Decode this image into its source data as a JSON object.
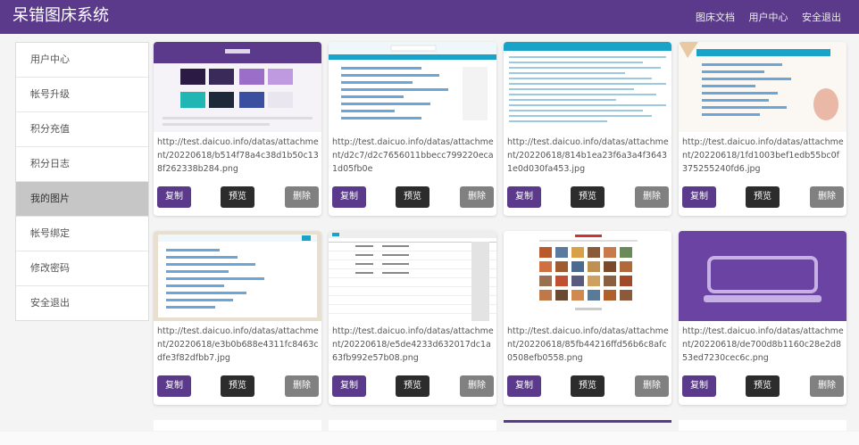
{
  "header": {
    "brand": "呆错图床系统",
    "nav": [
      "图床文档",
      "用户中心",
      "安全退出"
    ]
  },
  "sidebar": {
    "items": [
      "用户中心",
      "帐号升级",
      "积分充值",
      "积分日志",
      "我的图片",
      "帐号绑定",
      "修改密码",
      "安全退出"
    ],
    "active": "我的图片"
  },
  "cards": [
    {
      "url": "http://test.daicuo.info/datas/attachment/20220618/b514f78a4c38d1b50c138f262338b284.png",
      "thumb": "purple-site"
    },
    {
      "url": "http://test.daicuo.info/datas/attachment/d2c7/d2c7656011bbecc799220eca1d05fb0e",
      "thumb": "doc-list"
    },
    {
      "url": "http://test.daicuo.info/datas/attachment/20220618/814b1ea23f6a3a4f36431e0d030fa453.jpg",
      "thumb": "code-page"
    },
    {
      "url": "http://test.daicuo.info/datas/attachment/20220618/1fd1003bef1edb55bc0f375255240fd6.jpg",
      "thumb": "doc-list-deco"
    },
    {
      "url": "http://test.daicuo.info/datas/attachment/20220618/e3b0b688e4311fc8463cdfe3f82dfbb7.jpg",
      "thumb": "doc-framed"
    },
    {
      "url": "http://test.daicuo.info/datas/attachment/20220618/e5de4233d632017dc1a63fb992e57b08.png",
      "thumb": "table"
    },
    {
      "url": "http://test.daicuo.info/datas/attachment/20220618/85fb44216ffd56b6c8afc0508efb0558.png",
      "thumb": "image-grid"
    },
    {
      "url": "http://test.daicuo.info/datas/attachment/20220618/de700d8b1160c28e2d853ed7230cec6c.png",
      "thumb": "laptop-icon"
    }
  ],
  "buttons": {
    "copy": "复制",
    "preview": "预览",
    "delete": "删除"
  },
  "colors": {
    "brand": "#5b3a8c",
    "preview_btn": "#2c2c2c",
    "delete_btn": "#808080"
  }
}
